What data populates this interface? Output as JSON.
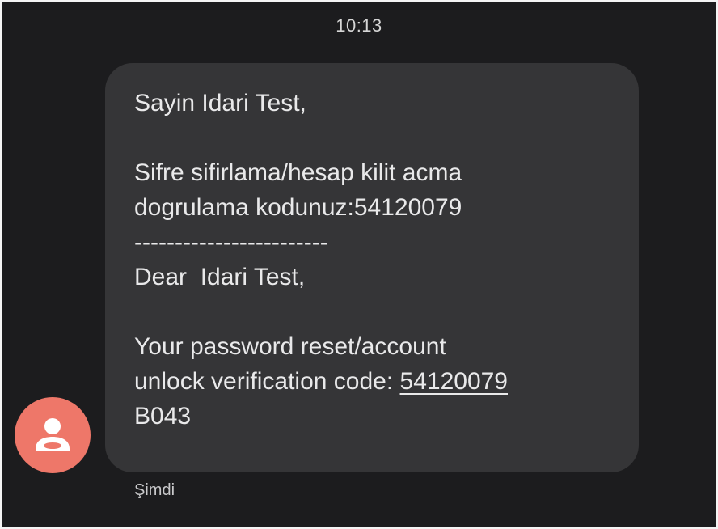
{
  "conversation": {
    "date_time": "10:13"
  },
  "message": {
    "greeting_tr": "Sayin Idari Test,",
    "body_tr_line1": "Sifre sifirlama/hesap kilit acma",
    "body_tr_line2": "dogrulama kodunuz:54120079",
    "separator": "------------------------",
    "greeting_en": "Dear  Idari Test,",
    "body_en_line1": "Your password reset/account",
    "body_en_line2_prefix": "unlock verification code: ",
    "verification_code": "54120079",
    "reference": "B043",
    "sent_time": "Şimdi"
  },
  "sender": {
    "avatar_icon": "person-icon",
    "avatar_color": "#ee7769"
  },
  "colors": {
    "background": "#1c1c1e",
    "bubble": "#353537",
    "text": "#e9e9ea"
  }
}
